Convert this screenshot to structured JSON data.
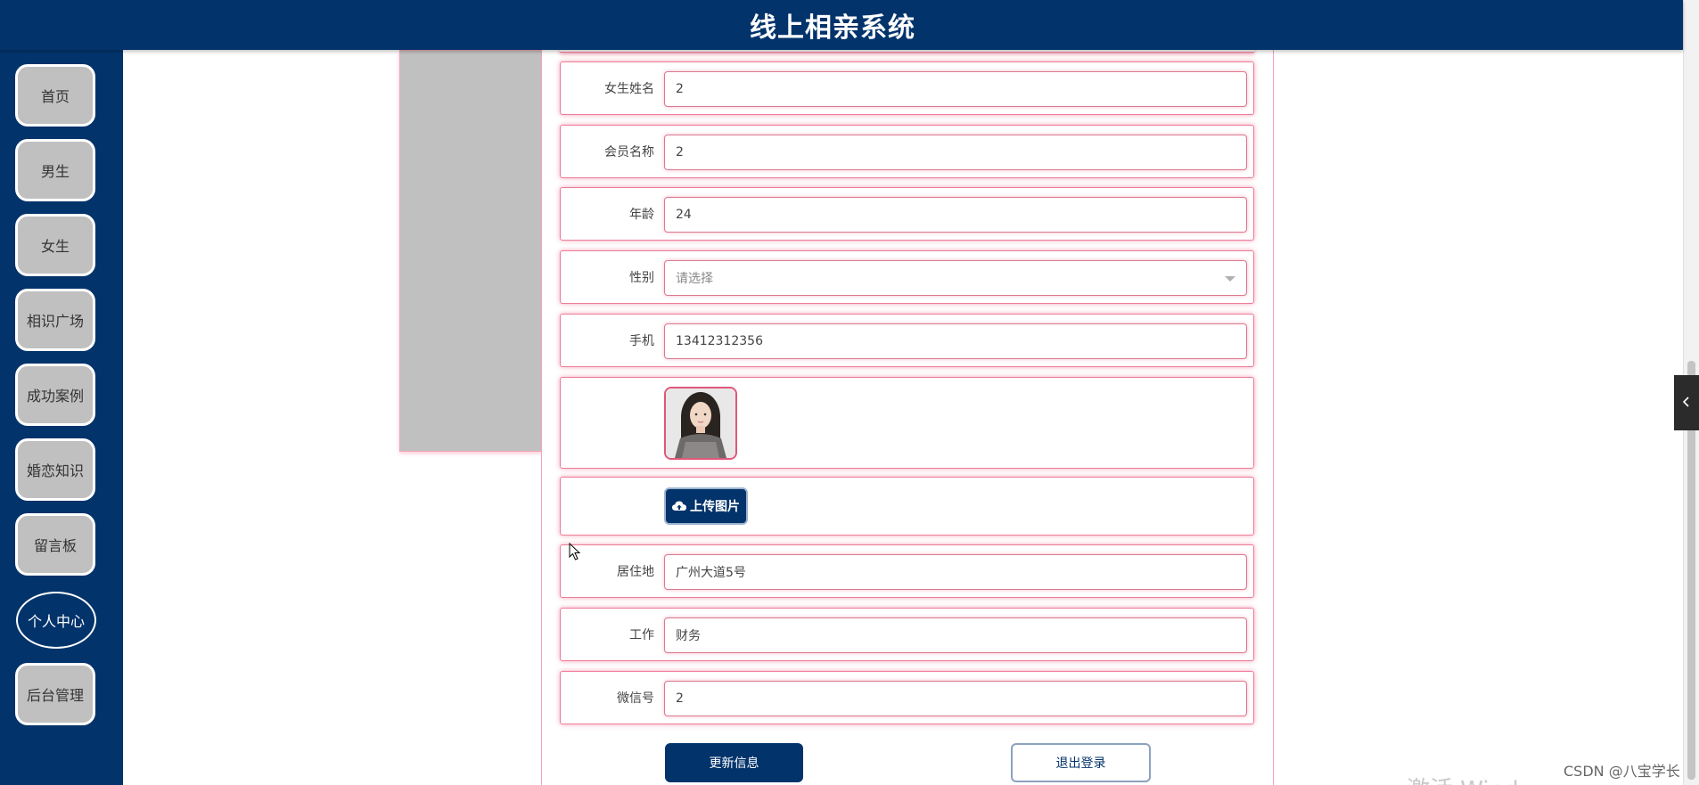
{
  "header": {
    "title": "线上相亲系统"
  },
  "sidebar": {
    "items": [
      {
        "label": "首页"
      },
      {
        "label": "男生"
      },
      {
        "label": "女生"
      },
      {
        "label": "相识广场"
      },
      {
        "label": "成功案例"
      },
      {
        "label": "婚恋知识"
      },
      {
        "label": "留言板"
      },
      {
        "label": "个人中心",
        "active": true
      },
      {
        "label": "后台管理"
      }
    ]
  },
  "form": {
    "female_name": {
      "label": "女生姓名",
      "value": "2"
    },
    "member_name": {
      "label": "会员名称",
      "value": "2"
    },
    "age": {
      "label": "年龄",
      "value": "24"
    },
    "gender": {
      "label": "性别",
      "placeholder": "请选择"
    },
    "phone": {
      "label": "手机",
      "value": "13412312356"
    },
    "upload_label": "上传图片",
    "address": {
      "label": "居住地",
      "value": "广州大道5号"
    },
    "job": {
      "label": "工作",
      "value": "财务"
    },
    "wechat": {
      "label": "微信号",
      "value": "2"
    }
  },
  "actions": {
    "update_label": "更新信息",
    "logout_label": "退出登录"
  },
  "watermark": "CSDN @八宝学长",
  "activate_text": "激活 Wind",
  "colors": {
    "primary": "#03336b",
    "accent_pink": "#e0567a"
  }
}
